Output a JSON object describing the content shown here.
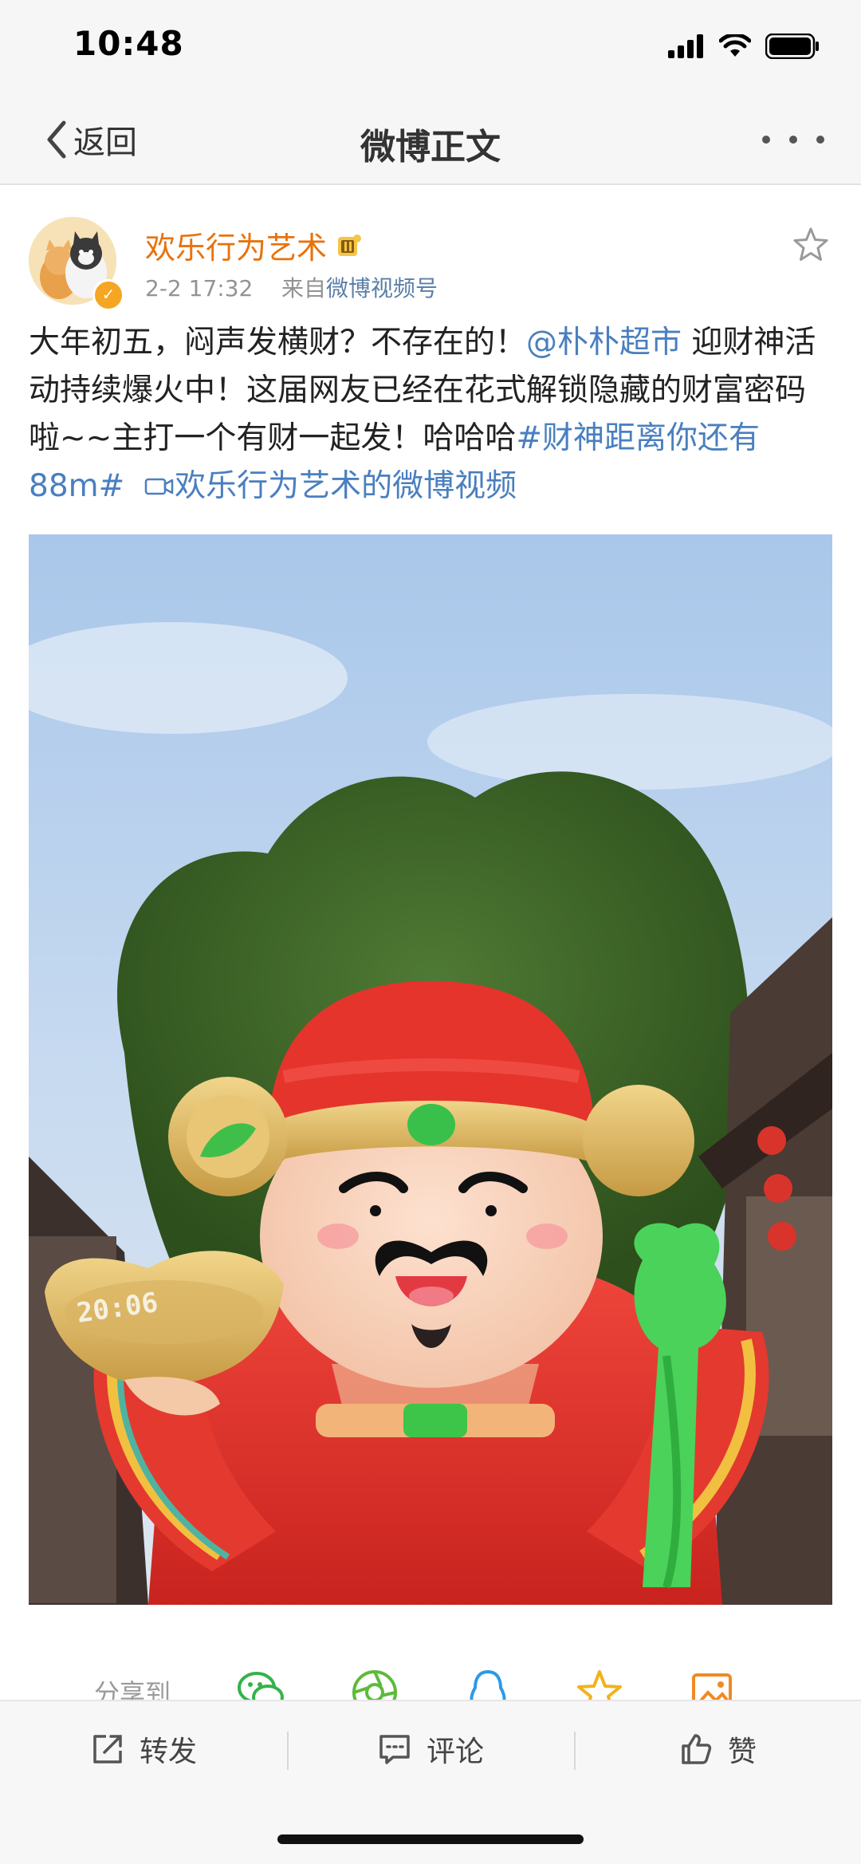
{
  "status_bar": {
    "time": "10:48"
  },
  "nav": {
    "back_label": "返回",
    "title": "微博正文"
  },
  "post": {
    "author": "欢乐行为艺术",
    "time": "2-2 17:32",
    "source_prefix": "来自",
    "source": "微博视频号",
    "text_part1": "大年初五，闷声发横财？不存在的！",
    "mention": "@朴朴超市",
    "text_part2": " 迎财神活动持续爆火中！这届网友已经在花式解锁隐藏的财富密码啦~~主打一个有财一起发！哈哈哈",
    "hashtag": "#财神距离你还有 88m#",
    "video_link": "欢乐行为艺术的微博视频"
  },
  "image": {
    "overlay_text": "20:06"
  },
  "share": {
    "label": "分享到"
  },
  "actions": {
    "repost": "转发",
    "comment": "评论",
    "like": "赞"
  },
  "colors": {
    "accent_link": "#4a7fbf",
    "username": "#e8720c",
    "verified": "#f5a623"
  }
}
